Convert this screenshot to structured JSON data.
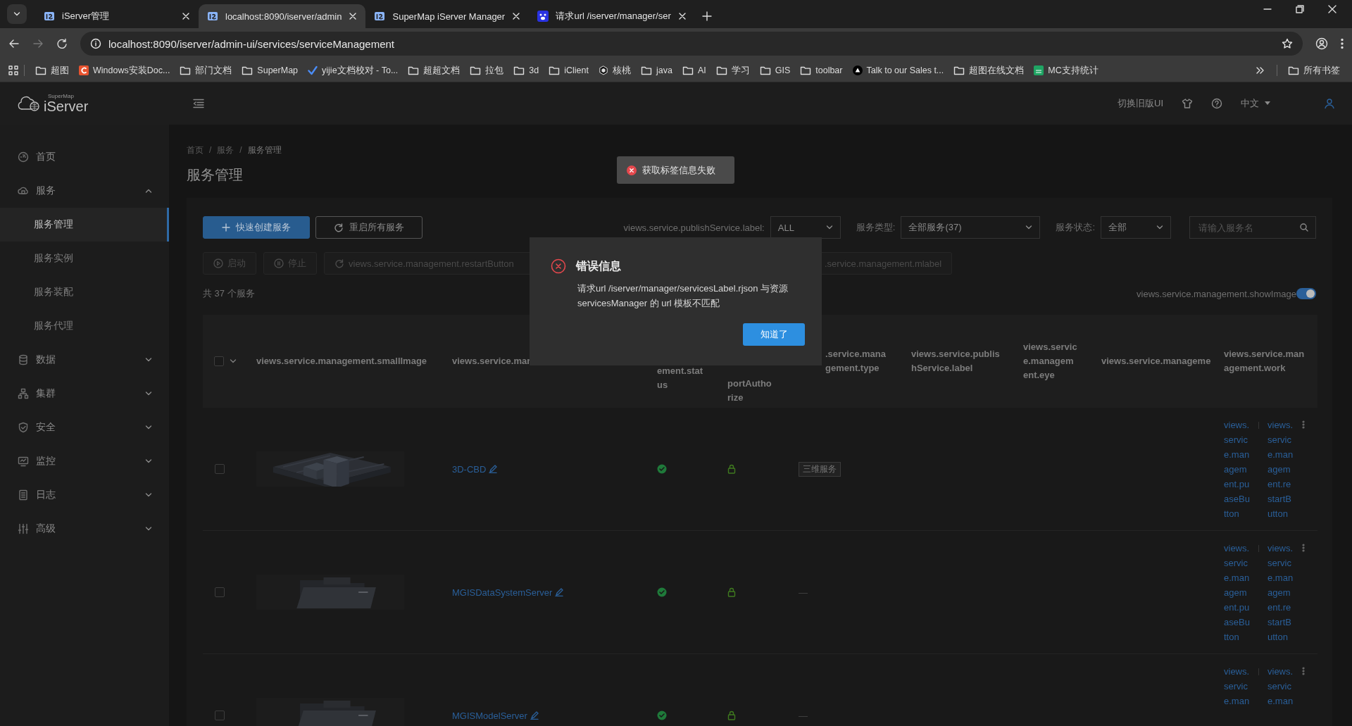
{
  "browser": {
    "tabs": [
      {
        "title": "iServer管理",
        "kind": "app",
        "selected": false
      },
      {
        "title": "localhost:8090/iserver/admin",
        "kind": "app",
        "selected": true
      },
      {
        "title": "SuperMap iServer Manager",
        "kind": "app",
        "selected": false
      },
      {
        "title": "请求url /iserver/manager/ser",
        "kind": "paw",
        "selected": false
      }
    ],
    "url": "localhost:8090/iserver/admin-ui/services/serviceManagement",
    "bookmarks": [
      {
        "label": "超图",
        "kind": "folder"
      },
      {
        "label": "Windows安装Doc...",
        "kind": "letter"
      },
      {
        "label": "部门文档",
        "kind": "folder"
      },
      {
        "label": "SuperMap",
        "kind": "folder"
      },
      {
        "label": "yijie文档校对 - To...",
        "kind": "check"
      },
      {
        "label": "超超文档",
        "kind": "folder"
      },
      {
        "label": "拉包",
        "kind": "folder"
      },
      {
        "label": "3d",
        "kind": "folder"
      },
      {
        "label": "iClient",
        "kind": "folder"
      },
      {
        "label": "核桃",
        "kind": "nut"
      },
      {
        "label": "java",
        "kind": "folder"
      },
      {
        "label": "AI",
        "kind": "folder"
      },
      {
        "label": "学习",
        "kind": "folder"
      },
      {
        "label": "GIS",
        "kind": "folder"
      },
      {
        "label": "toolbar",
        "kind": "folder"
      },
      {
        "label": "Talk to our Sales t...",
        "kind": "triangle"
      },
      {
        "label": "超图在线文档",
        "kind": "folder"
      },
      {
        "label": "MC支持统计",
        "kind": "sheet"
      }
    ],
    "all_bookmarks": "所有书签"
  },
  "header": {
    "logo_brand": "SuperMap",
    "logo_product": "iServer",
    "switch_ui": "切换旧版UI",
    "language": "中文"
  },
  "sidebar": {
    "items": [
      {
        "label": "首页",
        "selected": false
      },
      {
        "label": "服务",
        "selected": false,
        "expanded": true,
        "children": [
          {
            "label": "服务管理",
            "selected": true
          },
          {
            "label": "服务实例",
            "selected": false
          },
          {
            "label": "服务装配",
            "selected": false
          },
          {
            "label": "服务代理",
            "selected": false
          }
        ]
      },
      {
        "label": "数据",
        "selected": false,
        "expanded": false
      },
      {
        "label": "集群",
        "selected": false,
        "expanded": false
      },
      {
        "label": "安全",
        "selected": false,
        "expanded": false
      },
      {
        "label": "监控",
        "selected": false,
        "expanded": false
      },
      {
        "label": "日志",
        "selected": false,
        "expanded": false
      },
      {
        "label": "高级",
        "selected": false,
        "expanded": false
      }
    ]
  },
  "main": {
    "breadcrumb": {
      "separator": "/",
      "items": [
        "首页",
        "服务",
        "服务管理"
      ]
    },
    "title": "服务管理",
    "toast": "获取标签信息失败",
    "toolbar": {
      "create": "快速创建服务",
      "restart_all": "重启所有服务",
      "filters": [
        {
          "label": "views.service.publishService.label:",
          "value": "ALL"
        },
        {
          "label": "服务类型:",
          "value": "全部服务(37)"
        },
        {
          "label": "服务状态:",
          "value": "全部"
        }
      ],
      "search_placeholder": "请输入服务名"
    },
    "actions": [
      {
        "label": "启动",
        "kind": "play",
        "disabled": true
      },
      {
        "label": "停止",
        "kind": "pause",
        "disabled": true
      },
      {
        "label": "views.service.management.restartButton",
        "kind": "restart",
        "disabled": true
      },
      {
        "label": ".service.management.mlabel",
        "kind": "plain",
        "disabled": true
      }
    ],
    "count": "共 37 个服务",
    "show_image": {
      "label": "views.service.management.showImage",
      "on": true
    },
    "table": {
      "header_checked": false,
      "columns": [
        "views.service.management.smallImage",
        "views.service.mar",
        "ement.stat us",
        "portAutho rize",
        ".service.mana gement.type",
        "views.service.publis hService.label",
        "views.servic e.managem ent.eye",
        "views.service.manageme",
        "views.service.man agement.work"
      ],
      "rows": [
        {
          "checked": false,
          "name": "3D-CBD",
          "started": true,
          "locked": true,
          "type": {
            "kind": "tag",
            "text": "三维服务"
          },
          "actions": [
            "views.service.management.puaseButton",
            "views.service.management.restartButton"
          ]
        },
        {
          "checked": false,
          "name": "MGISDataSystemServer",
          "started": true,
          "locked": true,
          "type": {
            "kind": "plain",
            "text": "—"
          },
          "actions": [
            "views.service.management.puaseButton",
            "views.service.management.restartButton"
          ]
        },
        {
          "checked": false,
          "name": "MGISModelServer",
          "started": true,
          "locked": true,
          "type": {
            "kind": "plain",
            "text": "—"
          },
          "actions": [
            "views.service.man",
            "views.service.man"
          ]
        }
      ]
    },
    "dialog": {
      "title": "错误信息",
      "message": "请求url /iserver/manager/servicesLabel.rjson 与资源 servicesManager 的 url 模板不匹配",
      "button": "知道了"
    }
  }
}
